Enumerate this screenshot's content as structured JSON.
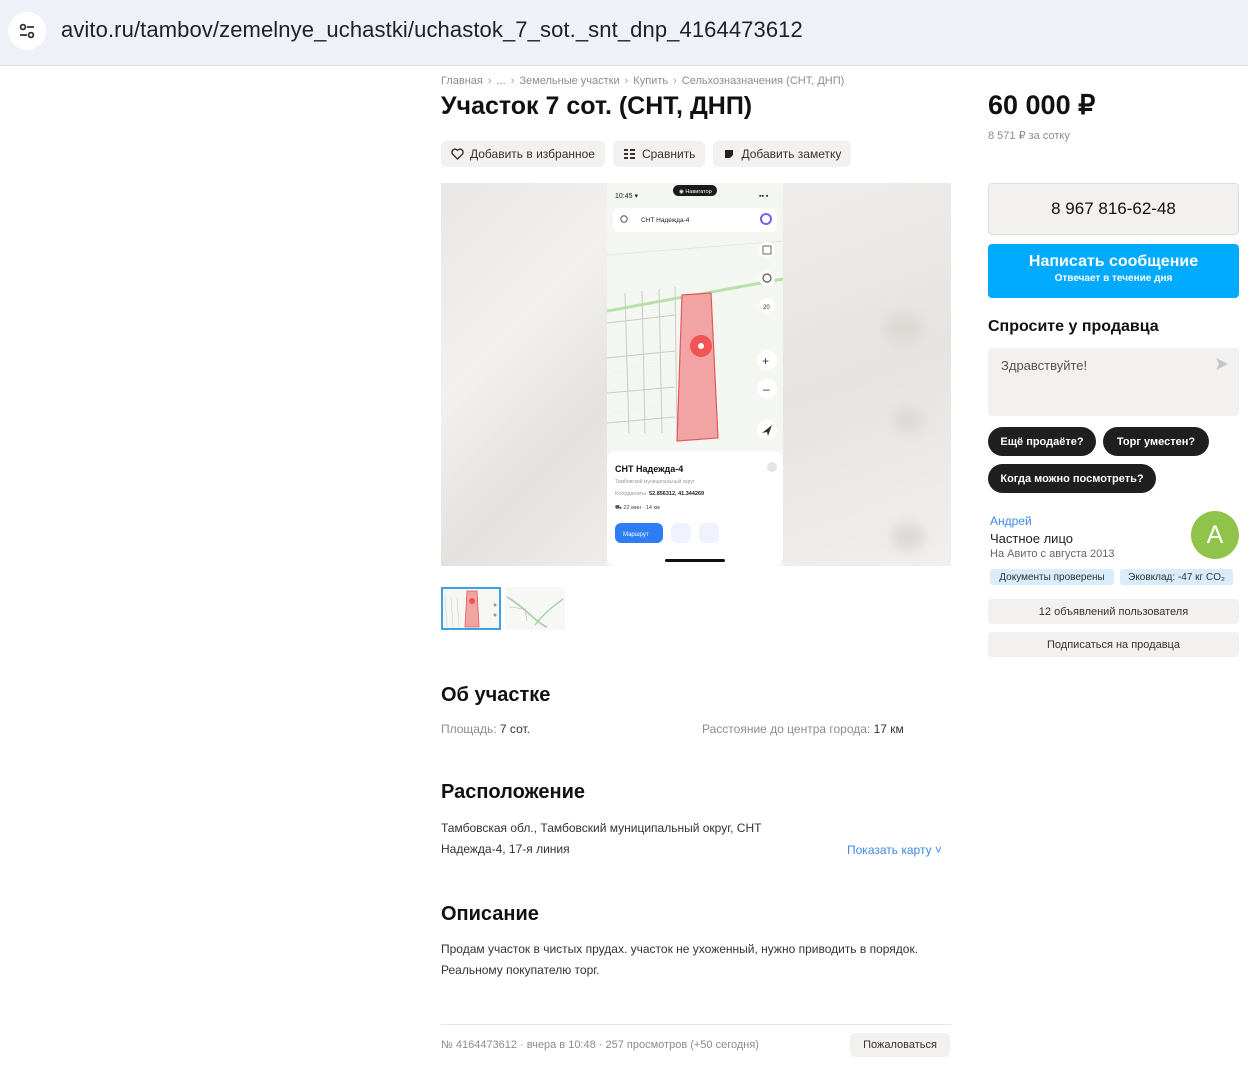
{
  "browser": {
    "url": "avito.ru/tambov/zemelnye_uchastki/uchastok_7_sot._snt_dnp_4164473612"
  },
  "breadcrumbs": [
    "Главная",
    "...",
    "Земельные участки",
    "Купить",
    "Сельхозназначения (СНТ, ДНП)"
  ],
  "listing": {
    "title": "Участок 7 сот. (СНТ, ДНП)",
    "actions": {
      "favorite": "Добавить в избранное",
      "compare": "Сравнить",
      "note": "Добавить заметку"
    },
    "photo": {
      "phone_time": "10:45",
      "nav_label": "Навигатор",
      "search_text": "СНТ Надежда-4",
      "zoom": "20",
      "place_title": "СНТ Надежда-4",
      "place_region": "Тамбовский муниципальный округ",
      "coords_label": "Координаты:",
      "coords": "52.856312, 41.344269",
      "travel": "22 мин · 14 км",
      "route_btn": "Маршрут"
    }
  },
  "about": {
    "heading": "Об участке",
    "area_label": "Площадь:",
    "area_value": "7 сот.",
    "dist_label": "Расстояние до центра города:",
    "dist_value": "17 км"
  },
  "location": {
    "heading": "Расположение",
    "address": "Тамбовская обл., Тамбовский муниципальный округ, СНТ Надежда-4, 17-я линия",
    "show_map": "Показать карту ˅"
  },
  "description": {
    "heading": "Описание",
    "text": "Продам участок в чистых прудах. участок не ухоженный, нужно приводить в порядок. Реальному покупателю торг."
  },
  "footer": {
    "meta": "№ 4164473612 · вчера в 10:48 · 257 просмотров (+50 сегодня)",
    "report": "Пожаловаться"
  },
  "sidebar": {
    "price": "60 000 ₽",
    "price_per": "8 571 ₽ за сотку",
    "phone": "8 967 816-62-48",
    "message_btn": "Написать сообщение",
    "message_sub": "Отвечает в течение дня",
    "ask_heading": "Спросите у продавца",
    "ask_placeholder": "Здравствуйте!",
    "chips": [
      "Ещё продаёте?",
      "Торг уместен?",
      "Когда можно посмотреть?"
    ],
    "seller": {
      "name": "Андрей",
      "type": "Частное лицо",
      "since": "На Авито с августа 2013",
      "avatar_letter": "А",
      "badges": [
        "Документы проверены",
        "Эковклад: -47 кг CO₂"
      ]
    },
    "listings_btn": "12 объявлений пользователя",
    "subscribe_btn": "Подписаться на продавца"
  },
  "colors": {
    "accent_blue": "#00aaff",
    "link_blue": "#3d8ae6",
    "avatar_green": "#8fc34a",
    "plot_red": "#f2a3a3"
  }
}
